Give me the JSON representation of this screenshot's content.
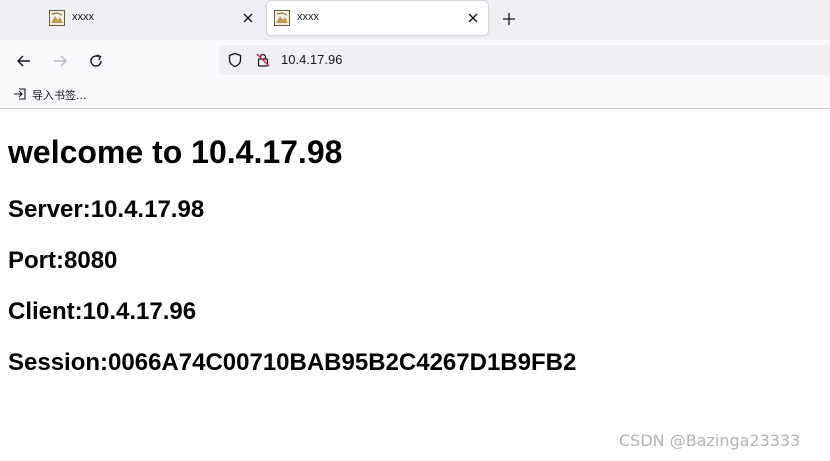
{
  "browser": {
    "tabs": [
      {
        "title": "xxxx",
        "active": false
      },
      {
        "title": "xxxx",
        "active": true
      }
    ],
    "address": "10.4.17.96",
    "bookmarks_bar": {
      "import_label": "导入书签..."
    }
  },
  "page": {
    "heading": "welcome to 10.4.17.98",
    "server": "Server:10.4.17.98",
    "port": "Port:8080",
    "client": "Client:10.4.17.96",
    "session": "Session:0066A74C00710BAB95B2C4267D1B9FB2"
  },
  "watermark": "CSDN @Bazinga23333",
  "icons": {
    "favicon": "page-favicon",
    "tab_close": "close-icon",
    "new_tab": "plus-icon",
    "back": "arrow-left-icon",
    "forward": "arrow-right-icon",
    "reload": "reload-icon",
    "tracking_protection": "shield-icon",
    "insecure_connection": "crossed-lock-icon",
    "import": "import-icon"
  },
  "colors": {
    "tabstrip_bg": "#f0f0f4",
    "toolbar_bg": "#f9f9fb",
    "insecure_lock": "#e22850",
    "watermark": "#b4b4b4"
  }
}
